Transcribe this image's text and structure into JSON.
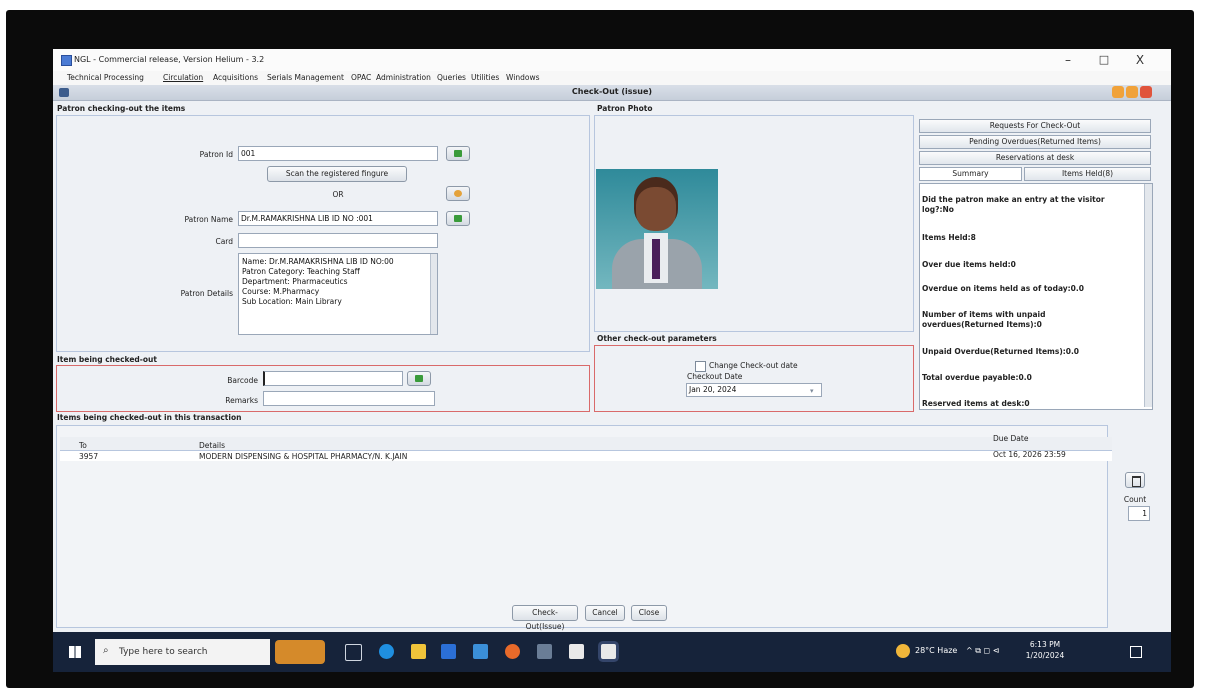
{
  "window": {
    "title": "NGL - Commercial release, Version Helium - 3.2",
    "controls": {
      "minimize": "–",
      "maximize": "□",
      "close": "X"
    }
  },
  "menu": [
    "Technical Processing",
    "Circulation",
    "Acquisitions",
    "Serials Management",
    "OPAC",
    "Administration",
    "Queries",
    "Utilities",
    "Windows"
  ],
  "inner_title": "Check-Out (issue)",
  "patron_section": {
    "header": "Patron checking-out the items",
    "patron_id_label": "Patron Id",
    "patron_id_value": "001",
    "scan_button": "Scan the registered fingure",
    "or_text": "OR",
    "patron_name_label": "Patron Name",
    "patron_name_value": "Dr.M.RAMAKRISHNA LIB ID NO :001",
    "card_label": "Card",
    "card_value": "",
    "details_label": "Patron Details",
    "details_lines": [
      "Name: Dr.M.RAMAKRISHNA LIB ID NO:00",
      "Patron Category: Teaching Staff",
      "Department: Pharmaceutics",
      "Course: M.Pharmacy",
      "Sub Location: Main Library"
    ]
  },
  "photo_section": {
    "header": "Patron Photo"
  },
  "side_tabs": {
    "requests": "Requests For Check-Out",
    "pending": "Pending Overdues(Returned Items)",
    "reservations": "Reservations at desk",
    "summary": "Summary",
    "items_held": "Items Held(8)"
  },
  "summary": {
    "lines": [
      "Did the patron make an entry at the visitor log?:No",
      "Items Held:8",
      "Over due items held:0",
      "Overdue on items held as of today:0.0",
      "Number of items with unpaid overdues(Returned Items):0",
      "Unpaid Overdue(Returned Items):0.0",
      "Total overdue payable:0.0",
      "Reserved items at desk:0"
    ]
  },
  "item_section": {
    "header": "Item being checked-out",
    "barcode_label": "Barcode",
    "barcode_value": "",
    "remarks_label": "Remarks",
    "remarks_value": ""
  },
  "params_section": {
    "header": "Other check-out parameters",
    "change_date_label": "Change Check-out date",
    "checkout_date_label": "Checkout Date",
    "checkout_date_value": "Jan 20, 2024"
  },
  "transaction": {
    "header": "Items being checked-out in this transaction",
    "columns": [
      "To",
      "Details",
      "Due Date"
    ],
    "rows": [
      {
        "to": "3957",
        "details": "MODERN DISPENSING & HOSPITAL PHARMACY/N. K.JAIN",
        "due": "Oct 16, 2026 23:59"
      }
    ],
    "count_label": "Count",
    "count_value": "1"
  },
  "buttons": {
    "checkout": "Check-Out(Issue)",
    "cancel": "Cancel",
    "close": "Close"
  },
  "taskbar": {
    "search_placeholder": "Type here to search",
    "weather": "28°C Haze",
    "time": "6:13 PM",
    "date": "1/20/2024"
  },
  "colors": {
    "accent_green": "#3a9b3a",
    "red_border": "#d96a6a",
    "panel_bg": "#eef1f5",
    "taskbar": "#16233a"
  }
}
